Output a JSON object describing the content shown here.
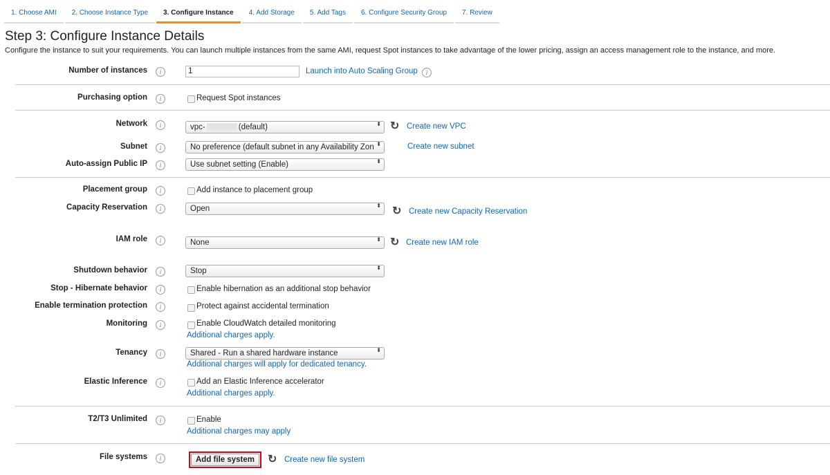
{
  "tabs": [
    {
      "label": "1. Choose AMI"
    },
    {
      "label": "2. Choose Instance Type"
    },
    {
      "label": "3. Configure Instance"
    },
    {
      "label": "4. Add Storage"
    },
    {
      "label": "5. Add Tags"
    },
    {
      "label": "6. Configure Security Group"
    },
    {
      "label": "7. Review"
    }
  ],
  "page": {
    "title": "Step 3: Configure Instance Details",
    "description": "Configure the instance to suit your requirements. You can launch multiple instances from the same AMI, request Spot instances to take advantage of the lower pricing, assign an access management role to the instance, and more."
  },
  "fields": {
    "num_instances": {
      "label": "Number of instances",
      "value": "1",
      "link": "Launch into Auto Scaling Group"
    },
    "purchasing": {
      "label": "Purchasing option",
      "checkbox": "Request Spot instances"
    },
    "network": {
      "label": "Network",
      "value_prefix": "vpc-",
      "value_suffix": "(default)",
      "link": "Create new VPC"
    },
    "subnet": {
      "label": "Subnet",
      "value": "No preference (default subnet in any Availability Zon",
      "link": "Create new subnet"
    },
    "public_ip": {
      "label": "Auto-assign Public IP",
      "value": "Use subnet setting (Enable)"
    },
    "placement": {
      "label": "Placement group",
      "checkbox": "Add instance to placement group"
    },
    "capacity": {
      "label": "Capacity Reservation",
      "value": "Open",
      "link": "Create new Capacity Reservation"
    },
    "iam": {
      "label": "IAM role",
      "value": "None",
      "link": "Create new IAM role"
    },
    "shutdown": {
      "label": "Shutdown behavior",
      "value": "Stop"
    },
    "hibernate": {
      "label": "Stop - Hibernate behavior",
      "checkbox": "Enable hibernation as an additional stop behavior"
    },
    "termination": {
      "label": "Enable termination protection",
      "checkbox": "Protect against accidental termination"
    },
    "monitoring": {
      "label": "Monitoring",
      "checkbox": "Enable CloudWatch detailed monitoring",
      "note": "Additional charges apply."
    },
    "tenancy": {
      "label": "Tenancy",
      "value": "Shared - Run a shared hardware instance",
      "note": "Additional charges will apply for dedicated tenancy."
    },
    "elastic": {
      "label": "Elastic Inference",
      "checkbox": "Add an Elastic Inference accelerator",
      "note": "Additional charges apply."
    },
    "t2t3": {
      "label": "T2/T3 Unlimited",
      "checkbox": "Enable",
      "note": "Additional charges may apply"
    },
    "filesystems": {
      "label": "File systems",
      "button": "Add file system",
      "link": "Create new file system"
    }
  },
  "icons": {
    "info": "i",
    "refresh": "↻",
    "select_arrow": "⬍"
  },
  "colors": {
    "link": "#1166bb",
    "active_tab": "#f08a24",
    "highlight": "#d0021b"
  }
}
